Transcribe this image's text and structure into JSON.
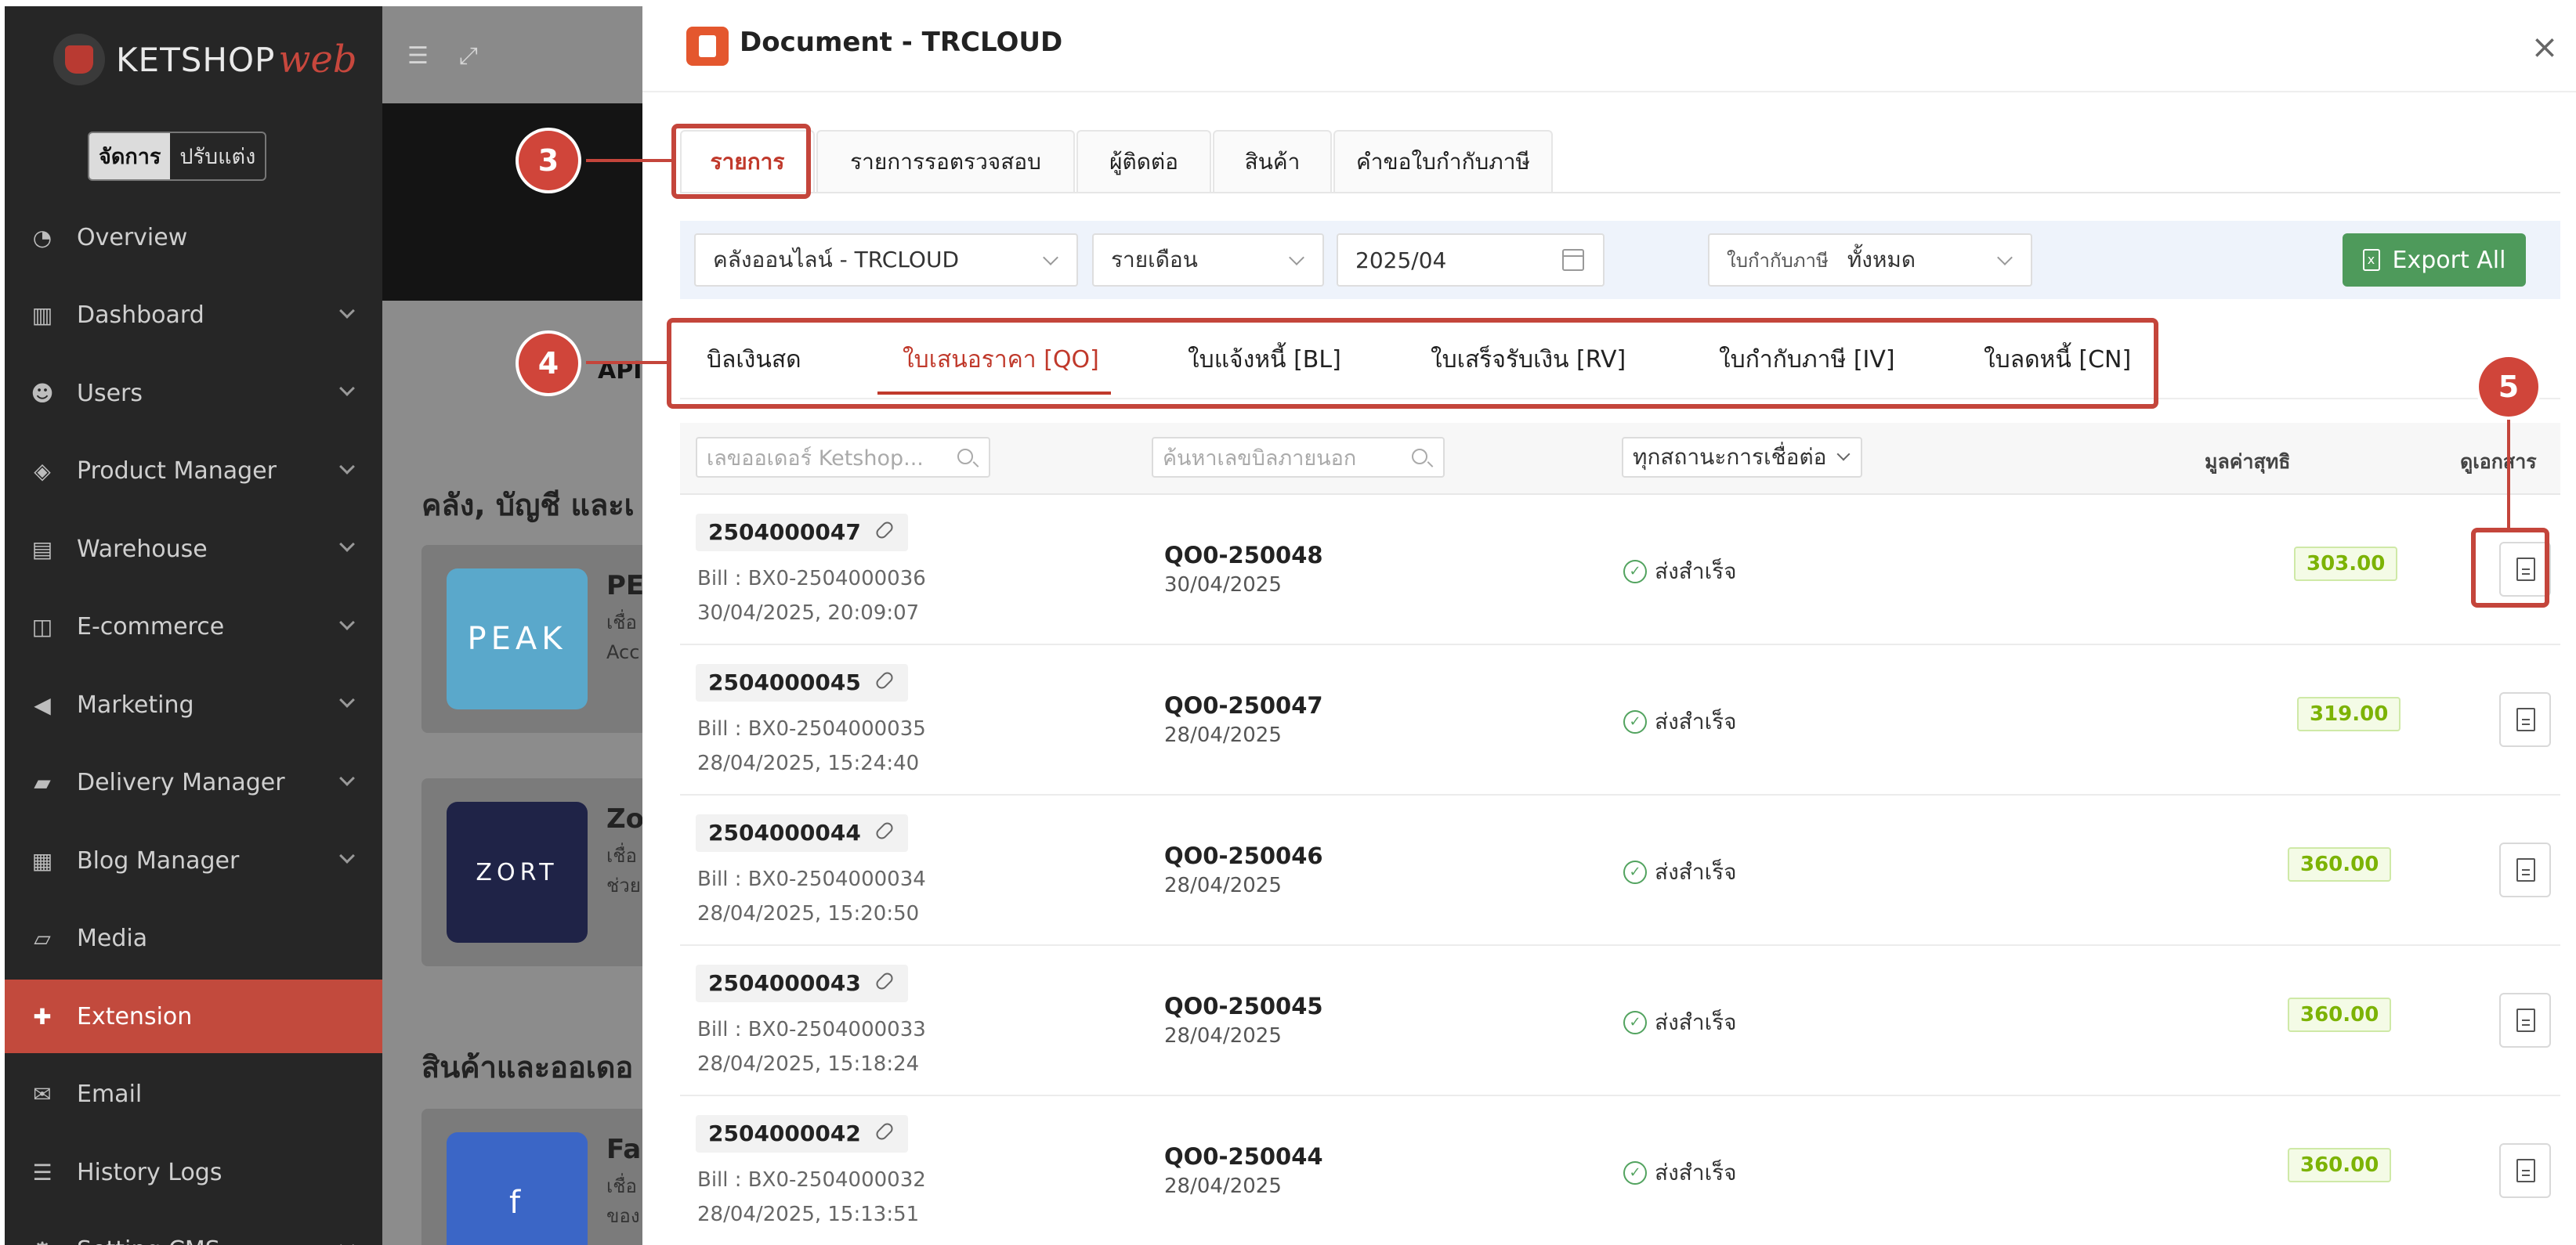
{
  "sidebar": {
    "logo_text": "KETSHOP",
    "logo_accent": "web",
    "mode_toggle": [
      "จัดการ",
      "ปรับแต่ง"
    ],
    "items": [
      {
        "label": "Overview",
        "icon": "pie-chart-icon",
        "glyph": "◔"
      },
      {
        "label": "Dashboard",
        "icon": "bar-chart-icon",
        "glyph": "▥"
      },
      {
        "label": "Users",
        "icon": "users-icon",
        "glyph": "☻"
      },
      {
        "label": "Product Manager",
        "icon": "tag-icon",
        "glyph": "◈"
      },
      {
        "label": "Warehouse",
        "icon": "warehouse-icon",
        "glyph": "▤"
      },
      {
        "label": "E-commerce",
        "icon": "cart-icon",
        "glyph": "◫"
      },
      {
        "label": "Marketing",
        "icon": "megaphone-icon",
        "glyph": "◀"
      },
      {
        "label": "Delivery Manager",
        "icon": "truck-icon",
        "glyph": "▰"
      },
      {
        "label": "Blog Manager",
        "icon": "newspaper-icon",
        "glyph": "▦"
      },
      {
        "label": "Media",
        "icon": "folder-icon",
        "glyph": "▱"
      },
      {
        "label": "Extension",
        "icon": "puzzle-icon",
        "glyph": "✚"
      },
      {
        "label": "Email",
        "icon": "envelope-icon",
        "glyph": "✉"
      },
      {
        "label": "History Logs",
        "icon": "list-icon",
        "glyph": "☰"
      },
      {
        "label": "Setting CMS",
        "icon": "gear-icon",
        "glyph": "⚙"
      }
    ]
  },
  "background": {
    "api_label": "API",
    "heading1": "คลัง, บัญชี และเ",
    "heading2": "สินค้าและออเดอ",
    "cards": [
      {
        "logo": "PEAK",
        "title": "PE",
        "sub1": "เชื่อ",
        "sub2": "Acc"
      },
      {
        "logo": "ZORT",
        "title": "Zo",
        "sub1": "เชื่อ",
        "sub2": "ช่วย"
      },
      {
        "logo": "f",
        "title": "Fa",
        "sub1": "เชื่อ",
        "sub2": "ของ"
      }
    ]
  },
  "drawer": {
    "title": "Document - TRCLOUD",
    "close": "×",
    "main_tabs": [
      "รายการ",
      "รายการรอตรวจสอบ",
      "ผู้ติดต่อ",
      "สินค้า",
      "คำขอใบกำกับภาษี"
    ],
    "filters": {
      "warehouse": "คลังออนไลน์ - TRCLOUD",
      "period": "รายเดือน",
      "month": "2025/04",
      "tax_invoice_label": "ใบกำกับภาษี",
      "tax_invoice_value": "ทั้งหมด",
      "export_label": "Export All",
      "export_icon": "excel-icon"
    },
    "sub_tabs": [
      "บิลเงินสด",
      "ใบเสนอราคา [QO]",
      "ใบแจ้งหนี้ [BL]",
      "ใบเสร็จรับเงิน [RV]",
      "ใบกำกับภาษี [IV]",
      "ใบลดหนี้ [CN]"
    ],
    "table": {
      "search_order_placeholder": "เลขออเดอร์ Ketshop...",
      "search_external_placeholder": "ค้นหาเลขบิลภายนอก",
      "status_filter": "ทุกสถานะการเชื่อต่อ",
      "col_net": "มูลค่าสุทธิ",
      "col_doc": "ดูเอกสาร",
      "rows": [
        {
          "order": "2504000047",
          "bill": "Bill : BX0-2504000036",
          "date": "30/04/2025, 20:09:07",
          "qo": "QO0-250048",
          "qo_date": "30/04/2025",
          "status": "ส่งสำเร็จ",
          "amount": "303.00"
        },
        {
          "order": "2504000045",
          "bill": "Bill : BX0-2504000035",
          "date": "28/04/2025, 15:24:40",
          "qo": "QO0-250047",
          "qo_date": "28/04/2025",
          "status": "ส่งสำเร็จ",
          "amount": "319.00"
        },
        {
          "order": "2504000044",
          "bill": "Bill : BX0-2504000034",
          "date": "28/04/2025, 15:20:50",
          "qo": "QO0-250046",
          "qo_date": "28/04/2025",
          "status": "ส่งสำเร็จ",
          "amount": "360.00"
        },
        {
          "order": "2504000043",
          "bill": "Bill : BX0-2504000033",
          "date": "28/04/2025, 15:18:24",
          "qo": "QO0-250045",
          "qo_date": "28/04/2025",
          "status": "ส่งสำเร็จ",
          "amount": "360.00"
        },
        {
          "order": "2504000042",
          "bill": "Bill : BX0-2504000032",
          "date": "28/04/2025, 15:13:51",
          "qo": "QO0-250044",
          "qo_date": "28/04/2025",
          "status": "ส่งสำเร็จ",
          "amount": "360.00"
        }
      ]
    }
  },
  "annotations": {
    "step3": "3",
    "step4": "4",
    "step5": "5"
  },
  "colors": {
    "accent": "#c0392b",
    "annotation": "#c4453b",
    "export": "#4e9a5b",
    "amount": "#7cb305",
    "sidebar": "#262626",
    "sidebar_active": "#c24a3d"
  }
}
